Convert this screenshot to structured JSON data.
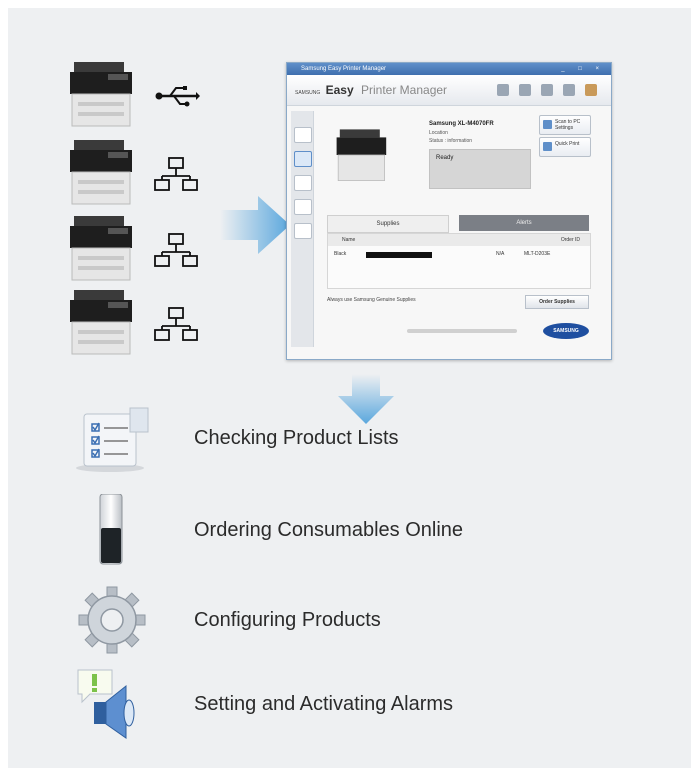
{
  "printers": [
    {
      "connection": "usb-icon"
    },
    {
      "connection": "network-icon"
    },
    {
      "connection": "network-icon"
    },
    {
      "connection": "network-icon"
    }
  ],
  "app_window": {
    "title": "Samsung Easy Printer Manager",
    "brand_prefix": "SAMSUNG",
    "brand_main": "Easy",
    "brand_sub": "Printer Manager",
    "device_name": "Samsung XL-M4070FR",
    "device_line1": "Location",
    "device_line2": "Status : information",
    "status_text": "Ready",
    "side_buttons": [
      "Scan to PC Settings",
      "Quick Print"
    ],
    "tabs": [
      "Supplies",
      "Alerts"
    ],
    "supplies_headers": [
      "Name",
      "Order ID"
    ],
    "supply_row": {
      "name": "Black",
      "pct": "N/A",
      "order_id": "MLT-D203E"
    },
    "footer_note": "Always use Samsung Genuine Supplies",
    "order_button": "Order Supplies",
    "logo": "SAMSUNG"
  },
  "features": [
    {
      "icon": "checklist-icon",
      "label": "Checking Product Lists"
    },
    {
      "icon": "toner-cartridge-icon",
      "label": "Ordering Consumables Online"
    },
    {
      "icon": "gear-icon",
      "label": "Configuring Products"
    },
    {
      "icon": "alarm-speaker-icon",
      "label": "Setting and Activating Alarms"
    }
  ],
  "colors": {
    "background": "#eef0f2",
    "arrow": "#5aa7dd",
    "text": "#2b2b2b"
  }
}
